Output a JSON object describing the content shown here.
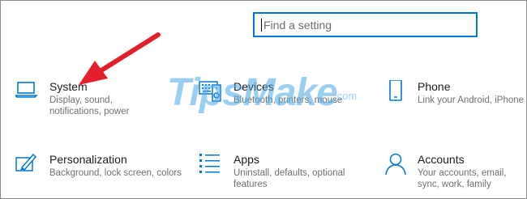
{
  "search": {
    "placeholder": "Find a setting"
  },
  "tiles": {
    "system": {
      "title": "System",
      "desc": "Display, sound, notifications, power",
      "icon": "laptop-icon"
    },
    "devices": {
      "title": "Devices",
      "desc": "Bluetooth, printers, mouse",
      "icon": "keyboard-speaker-icon"
    },
    "phone": {
      "title": "Phone",
      "desc": "Link your Android, iPhone",
      "icon": "phone-icon"
    },
    "personalization": {
      "title": "Personalization",
      "desc": "Background, lock screen, colors",
      "icon": "paint-pen-icon"
    },
    "apps": {
      "title": "Apps",
      "desc": "Uninstall, defaults, optional features",
      "icon": "apps-list-icon"
    },
    "accounts": {
      "title": "Accounts",
      "desc": "Your accounts, email, sync, work, family",
      "icon": "person-icon"
    }
  },
  "watermark": {
    "text": "TipsMake",
    "sub": ".com"
  },
  "colors": {
    "accent": "#0078d7",
    "arrow": "#e3202a"
  }
}
